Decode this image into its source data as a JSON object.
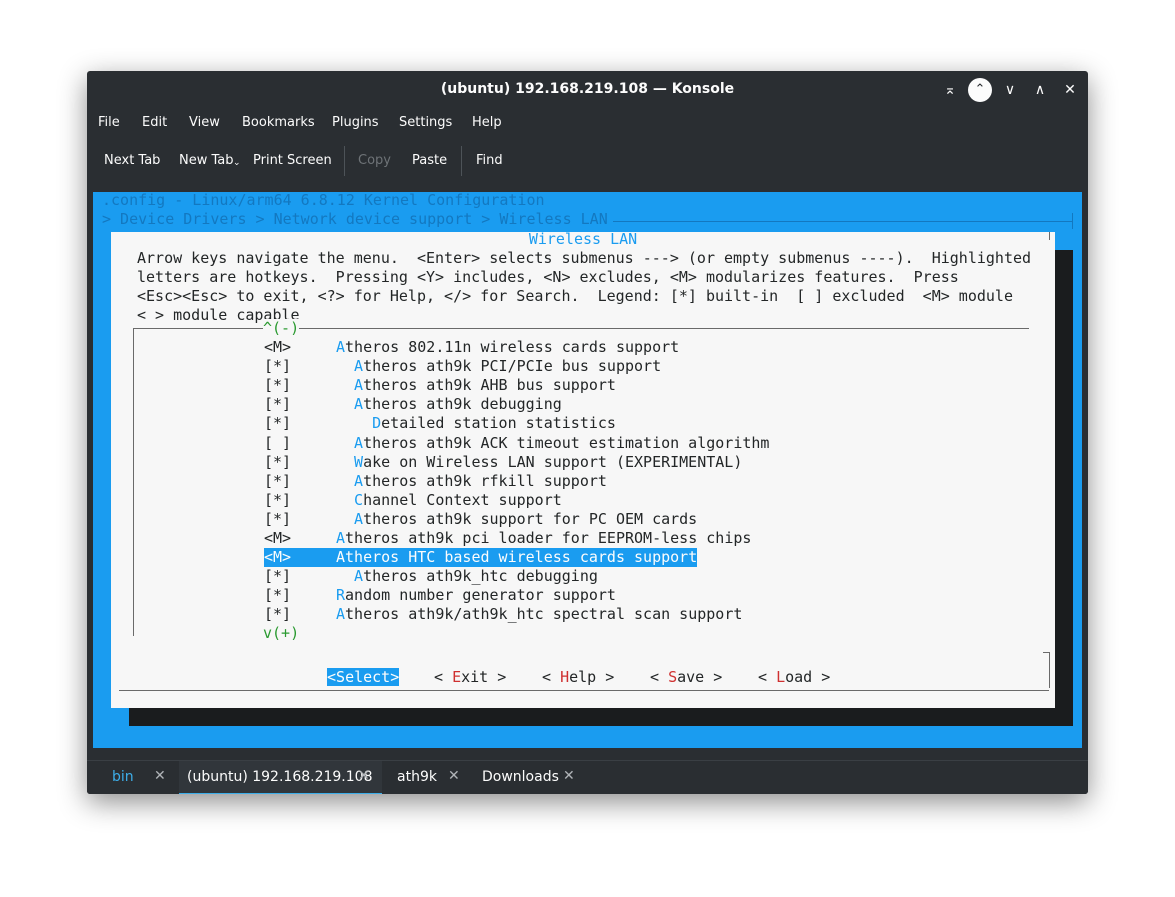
{
  "window": {
    "title": "(ubuntu) 192.168.219.108 — Konsole"
  },
  "menubar": [
    "File",
    "Edit",
    "View",
    "Bookmarks",
    "Plugins",
    "Settings",
    "Help"
  ],
  "toolbar": {
    "next_tab": "Next Tab",
    "new_tab": "New Tab",
    "print_screen": "Print Screen",
    "copy": "Copy",
    "paste": "Paste",
    "find": "Find"
  },
  "terminal": {
    "header_line": ".config - Linux/arm64 6.8.12 Kernel Configuration",
    "breadcrumb": "> Device Drivers > Network device support > Wireless LAN ",
    "dialog_title": "Wireless LAN",
    "help_lines": [
      "Arrow keys navigate the menu.  <Enter> selects submenus ---> (or empty submenus ----).  Highlighted",
      "letters are hotkeys.  Pressing <Y> includes, <N> excludes, <M> modularizes features.  Press",
      "<Esc><Esc> to exit, <?> for Help, </> for Search.  Legend: [*] built-in  [ ] excluded  <M> module",
      "< > module capable"
    ],
    "scroll_up": "^(-)",
    "scroll_down": "v(+)",
    "items": [
      {
        "state": "<M>",
        "indent": "    ",
        "hot": "A",
        "rest": "theros 802.11n wireless cards support",
        "selected": false
      },
      {
        "state": "[*]",
        "indent": "      ",
        "hot": "A",
        "rest": "theros ath9k PCI/PCIe bus support",
        "selected": false
      },
      {
        "state": "[*]",
        "indent": "      ",
        "hot": "A",
        "rest": "theros ath9k AHB bus support",
        "selected": false
      },
      {
        "state": "[*]",
        "indent": "      ",
        "hot": "A",
        "rest": "theros ath9k debugging",
        "selected": false
      },
      {
        "state": "[*]",
        "indent": "        ",
        "hot": "D",
        "rest": "etailed station statistics",
        "selected": false
      },
      {
        "state": "[ ]",
        "indent": "      ",
        "hot": "A",
        "rest": "theros ath9k ACK timeout estimation algorithm",
        "selected": false
      },
      {
        "state": "[*]",
        "indent": "      ",
        "hot": "W",
        "rest": "ake on Wireless LAN support (EXPERIMENTAL)",
        "selected": false
      },
      {
        "state": "[*]",
        "indent": "      ",
        "hot": "A",
        "rest": "theros ath9k rfkill support",
        "selected": false
      },
      {
        "state": "[*]",
        "indent": "      ",
        "hot": "C",
        "rest": "hannel Context support",
        "selected": false
      },
      {
        "state": "[*]",
        "indent": "      ",
        "hot": "A",
        "rest": "theros ath9k support for PC OEM cards",
        "selected": false
      },
      {
        "state": "<M>",
        "indent": "    ",
        "hot": "A",
        "rest": "theros ath9k pci loader for EEPROM-less chips",
        "selected": false
      },
      {
        "state": "<M>",
        "indent": "    ",
        "hot": "A",
        "rest": "theros HTC based wireless cards support",
        "selected": true
      },
      {
        "state": "[*]",
        "indent": "      ",
        "hot": "A",
        "rest": "theros ath9k_htc debugging",
        "selected": false
      },
      {
        "state": "[*]",
        "indent": "    ",
        "hot": "R",
        "rest": "andom number generator support",
        "selected": false
      },
      {
        "state": "[*]",
        "indent": "    ",
        "hot": "A",
        "rest": "theros ath9k/ath9k_htc spectral scan support",
        "selected": false
      }
    ],
    "buttons": [
      {
        "pre": "<",
        "hot": "S",
        "rest": "elect",
        "post": ">",
        "selected": true
      },
      {
        "pre": "< ",
        "hot": "E",
        "rest": "xit",
        "post": " >",
        "selected": false
      },
      {
        "pre": "< ",
        "hot": "H",
        "rest": "elp",
        "post": " >",
        "selected": false
      },
      {
        "pre": "< ",
        "hot": "S",
        "rest": "ave",
        "post": " >",
        "selected": false
      },
      {
        "pre": "< ",
        "hot": "L",
        "rest": "oad",
        "post": " >",
        "selected": false
      }
    ]
  },
  "tabs": [
    {
      "label": "bin",
      "active": false
    },
    {
      "label": "(ubuntu) 192.168.219.108",
      "active": true
    },
    {
      "label": "ath9k",
      "active": false
    },
    {
      "label": "Downloads",
      "active": false
    }
  ],
  "tab_close_glyph": "✕"
}
